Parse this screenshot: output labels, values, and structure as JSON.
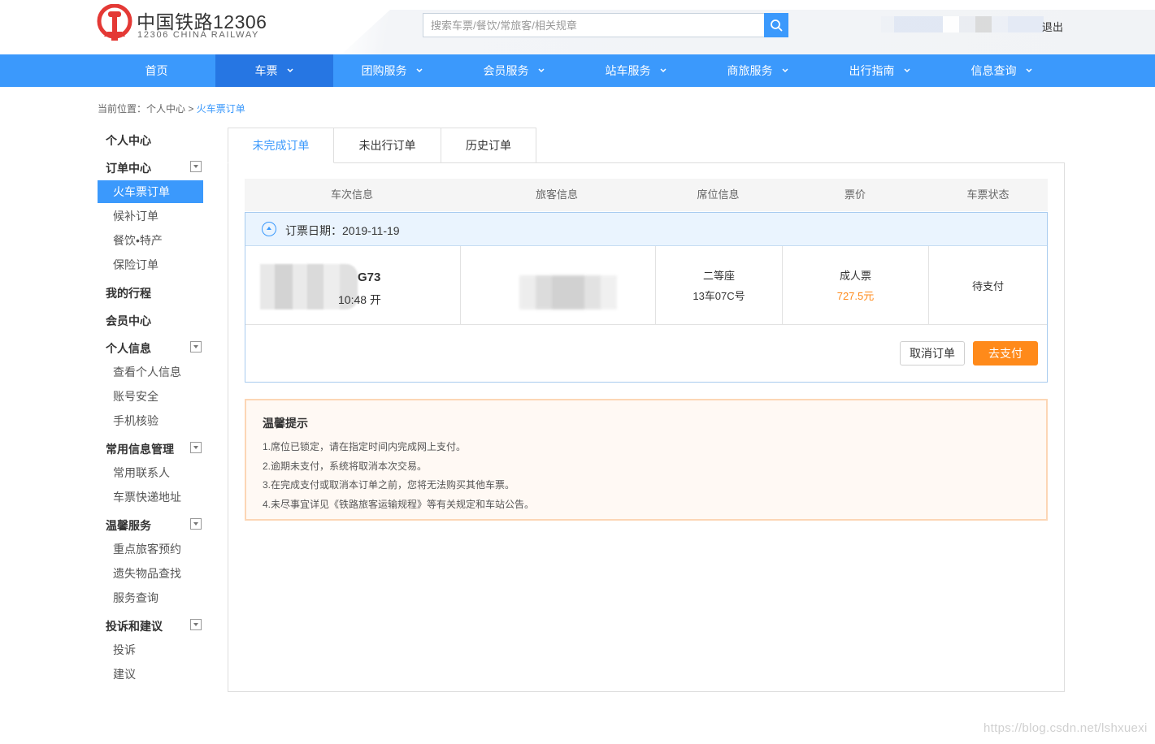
{
  "brand": {
    "name_cn": "中国铁路12306",
    "name_en": "12306 CHINA RAILWAY",
    "logo_icon": "railway-logo-icon",
    "logo_color": "#e43935"
  },
  "header": {
    "search_placeholder": "搜索车票/餐饮/常旅客/相关规章",
    "search_icon": "search-icon",
    "logout_label": "退出"
  },
  "colors": {
    "primary": "#3b99fc",
    "nav_active": "#2676e3",
    "pay_orange": "#ff8a1a",
    "tips_border": "#fcd6b5"
  },
  "nav": [
    {
      "label": "首页",
      "dropdown": false,
      "active": false
    },
    {
      "label": "车票",
      "dropdown": true,
      "active": true
    },
    {
      "label": "团购服务",
      "dropdown": true,
      "active": false
    },
    {
      "label": "会员服务",
      "dropdown": true,
      "active": false
    },
    {
      "label": "站车服务",
      "dropdown": true,
      "active": false
    },
    {
      "label": "商旅服务",
      "dropdown": true,
      "active": false
    },
    {
      "label": "出行指南",
      "dropdown": true,
      "active": false
    },
    {
      "label": "信息查询",
      "dropdown": true,
      "active": false
    }
  ],
  "breadcrumb": {
    "prefix": "当前位置：",
    "parent": "个人中心",
    "separator": " > ",
    "current": "火车票订单"
  },
  "sidebar": {
    "home": "个人中心",
    "orders": {
      "title": "订单中心",
      "items": [
        "火车票订单",
        "候补订单",
        "餐饮•特产",
        "保险订单"
      ]
    },
    "trips": "我的行程",
    "member": "会员中心",
    "personal": {
      "title": "个人信息",
      "items": [
        "查看个人信息",
        "账号安全",
        "手机核验"
      ]
    },
    "common": {
      "title": "常用信息管理",
      "items": [
        "常用联系人",
        "车票快递地址"
      ]
    },
    "services": {
      "title": "温馨服务",
      "items": [
        "重点旅客预约",
        "遗失物品查找",
        "服务查询"
      ]
    },
    "feedback": {
      "title": "投诉和建议",
      "items": [
        "投诉",
        "建议"
      ]
    }
  },
  "tabs": [
    "未完成订单",
    "未出行订单",
    "历史订单"
  ],
  "table": {
    "headers": [
      "车次信息",
      "旅客信息",
      "席位信息",
      "票价",
      "车票状态"
    ],
    "date_label": "订票日期：2019-11-19",
    "train_no": "G73",
    "departure": "10:48 开",
    "seat_class": "二等座",
    "seat_no": "13车07C号",
    "ticket_type": "成人票",
    "price": "727.5元",
    "status": "待支付",
    "cancel_label": "取消订单",
    "pay_label": "去支付"
  },
  "tips": {
    "title": "温馨提示",
    "items": [
      "1.席位已锁定，请在指定时间内完成网上支付。",
      "2.逾期未支付，系统将取消本次交易。",
      "3.在完成支付或取消本订单之前，您将无法购买其他车票。",
      "4.未尽事宜详见《铁路旅客运输规程》等有关规定和车站公告。"
    ]
  },
  "watermark": "https://blog.csdn.net/lshxuexi"
}
